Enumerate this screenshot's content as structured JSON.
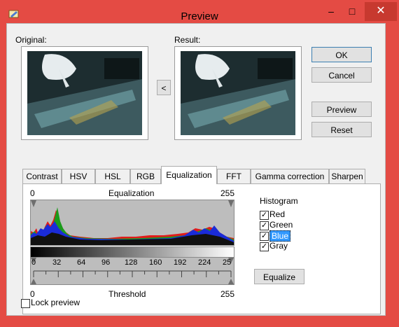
{
  "window": {
    "title": "Preview",
    "icon": "pencil-app-icon"
  },
  "labels": {
    "original": "Original:",
    "result": "Result:"
  },
  "buttons": {
    "ok": "OK",
    "cancel": "Cancel",
    "preview": "Preview",
    "reset": "Reset",
    "swap": "<",
    "equalize": "Equalize"
  },
  "tabs": [
    "Contrast",
    "HSV",
    "HSL",
    "RGB",
    "Equalization",
    "FFT",
    "Gamma correction",
    "Sharpen"
  ],
  "active_tab": "Equalization",
  "equalization": {
    "top_label": "Equalization",
    "top_min": "0",
    "top_max": "255",
    "bottom_label": "Threshold",
    "bottom_min": "0",
    "bottom_max": "255",
    "ruler_ticks": [
      "0",
      "32",
      "64",
      "96",
      "128",
      "160",
      "192",
      "224",
      "25"
    ]
  },
  "histogram": {
    "title": "Histogram",
    "items": [
      {
        "label": "Red",
        "checked": true,
        "selected": false
      },
      {
        "label": "Green",
        "checked": true,
        "selected": false
      },
      {
        "label": "Blue",
        "checked": true,
        "selected": true
      },
      {
        "label": "Gray",
        "checked": true,
        "selected": false
      }
    ]
  },
  "lock_preview": {
    "label": "Lock preview",
    "checked": false
  },
  "colors": {
    "title_bar": "#e44b44",
    "close": "#c7392f",
    "selection": "#3399ff"
  }
}
